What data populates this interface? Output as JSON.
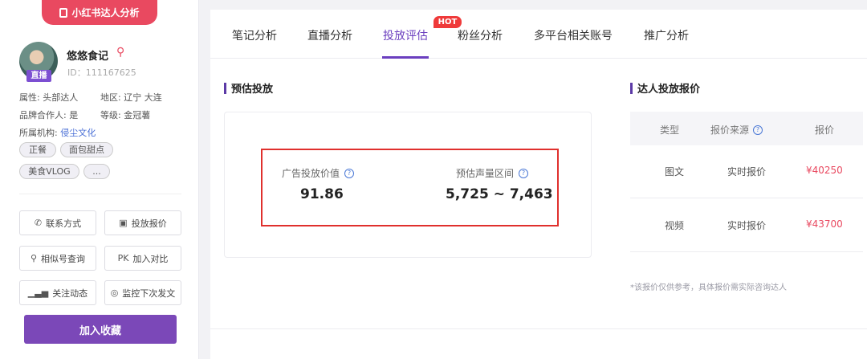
{
  "sidebar": {
    "banner": "小红书达人分析",
    "name": "悠悠食记",
    "id": "ID：111167625",
    "live_badge": "直播",
    "attr": "属性: 头部达人",
    "region": "地区: 辽宁 大连",
    "brand_partner": "品牌合作人: 是",
    "level": "等级: 金冠薯",
    "org_label": "所属机构:",
    "org_value": "侵尘文化",
    "tags": [
      "正餐",
      "面包甜点",
      "美食VLOG",
      "..."
    ],
    "buttons": {
      "contact": "联系方式",
      "quote": "投放报价",
      "similar": "相似号查询",
      "compare": "加入对比",
      "follow": "关注动态",
      "monitor": "监控下次发文"
    },
    "collect": "加入收藏"
  },
  "tabs": [
    "笔记分析",
    "直播分析",
    "投放评估",
    "粉丝分析",
    "多平台相关账号",
    "推广分析"
  ],
  "active_tab": "投放评估",
  "hot_badge": "HOT",
  "estimate": {
    "title": "预估投放",
    "ad_value_label": "广告投放价值",
    "ad_value": "91.86",
    "volume_label": "预估声量区间",
    "volume": "5,725 ~ 7,463"
  },
  "pricing": {
    "title": "达人投放报价",
    "headers": [
      "类型",
      "报价来源",
      "报价"
    ],
    "rows": [
      {
        "type": "图文",
        "source": "实时报价",
        "price": "¥40250"
      },
      {
        "type": "视频",
        "source": "实时报价",
        "price": "¥43700"
      }
    ],
    "note": "*该报价仅供参考，具体报价需实际咨询达人"
  },
  "colors": {
    "accent": "#6b3fbf",
    "brand_red": "#e94960",
    "highlight_border": "#e0302d",
    "collect_button": "#7b48b8"
  }
}
